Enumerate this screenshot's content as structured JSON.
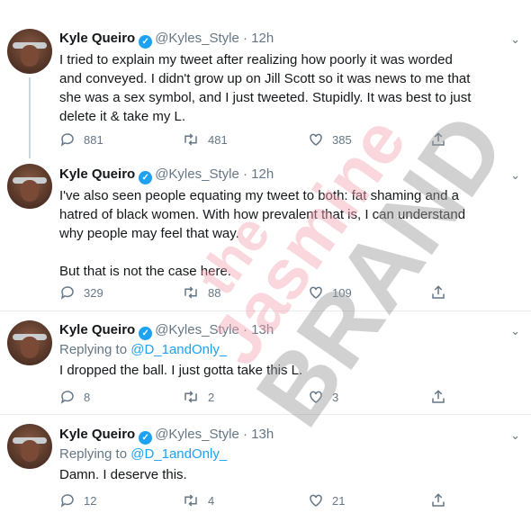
{
  "tweets": [
    {
      "name": "Kyle Queiro",
      "handle": "@Kyles_Style",
      "dot": "·",
      "time": "12h",
      "replying_to_prefix": "",
      "replying_to_handle": "",
      "text": [
        "I tried to explain my tweet after realizing how poorly it was worded",
        "and conveyed. I didn't grow up on Jill Scott so it was news to me that",
        "she was a sex symbol, and I just tweeted. Stupidly. It was best to just",
        "delete it & take my L."
      ],
      "replies": "881",
      "retweets": "481",
      "likes": "385"
    },
    {
      "name": "Kyle Queiro",
      "handle": "@Kyles_Style",
      "dot": "·",
      "time": "12h",
      "replying_to_prefix": "",
      "replying_to_handle": "",
      "text": [
        "I've also seen people equating my tweet to both: fat shaming and a",
        "hatred of black women. With how prevalent that is, I can understand",
        "why people may feel that way.",
        "",
        "But that is not the case here."
      ],
      "replies": "329",
      "retweets": "88",
      "likes": "109"
    },
    {
      "name": "Kyle Queiro",
      "handle": "@Kyles_Style",
      "dot": "·",
      "time": "13h",
      "replying_to_prefix": "Replying to",
      "replying_to_handle": "@D_1andOnly_",
      "text": [
        "I dropped the ball. I just gotta take this L."
      ],
      "replies": "8",
      "retweets": "2",
      "likes": "3"
    },
    {
      "name": "Kyle Queiro",
      "handle": "@Kyles_Style",
      "dot": "·",
      "time": "13h",
      "replying_to_prefix": "Replying to",
      "replying_to_handle": "@D_1andOnly_",
      "text": [
        "Damn. I deserve this."
      ],
      "replies": "12",
      "retweets": "4",
      "likes": "21"
    }
  ],
  "watermark": {
    "line1": "the",
    "line2": "Jasmine",
    "line3": "BRAND"
  },
  "colors": {
    "verified": "#1da1f2",
    "muted": "#657786",
    "mention": "#1da1f2",
    "watermark_pink": "#f4a3b4",
    "watermark_gray": "#9a9a9a"
  }
}
